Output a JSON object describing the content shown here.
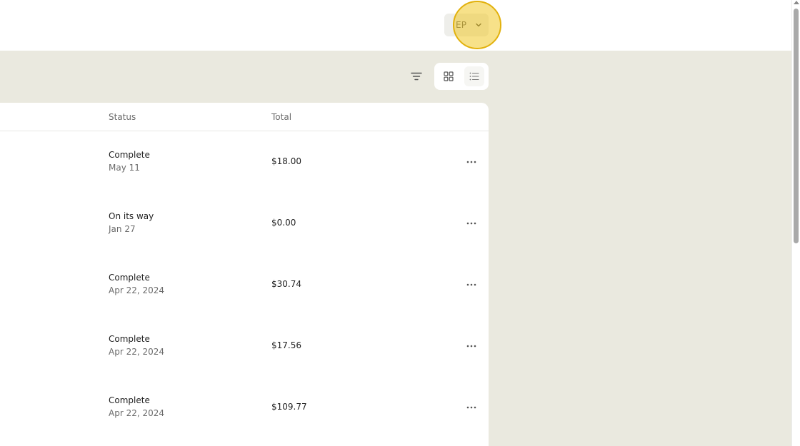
{
  "header": {
    "account_initials": "EP",
    "account_chevron_icon": "chevron-down-icon"
  },
  "toolbar": {
    "filter_icon": "filter-icon",
    "grid_view_icon": "grid-view-icon",
    "list_view_icon": "list-view-icon",
    "active_view": "list"
  },
  "orders_table": {
    "columns": {
      "status": "Status",
      "total": "Total"
    },
    "rows": [
      {
        "status": "Complete",
        "date": "May 11",
        "total": "$18.00"
      },
      {
        "status": "On its way",
        "date": "Jan 27",
        "total": "$0.00"
      },
      {
        "status": "Complete",
        "date": "Apr 22, 2024",
        "total": "$30.74"
      },
      {
        "status": "Complete",
        "date": "Apr 22, 2024",
        "total": "$17.56"
      },
      {
        "status": "Complete",
        "date": "Apr 22, 2024",
        "total": "$109.77"
      }
    ],
    "row_menu_icon": "more-horizontal-icon"
  },
  "colors": {
    "page_background": "#eae9df",
    "card_background": "#ffffff",
    "text_primary": "#1f1f1f",
    "text_secondary": "#6b6b6b",
    "highlight": "#e2b10d"
  }
}
